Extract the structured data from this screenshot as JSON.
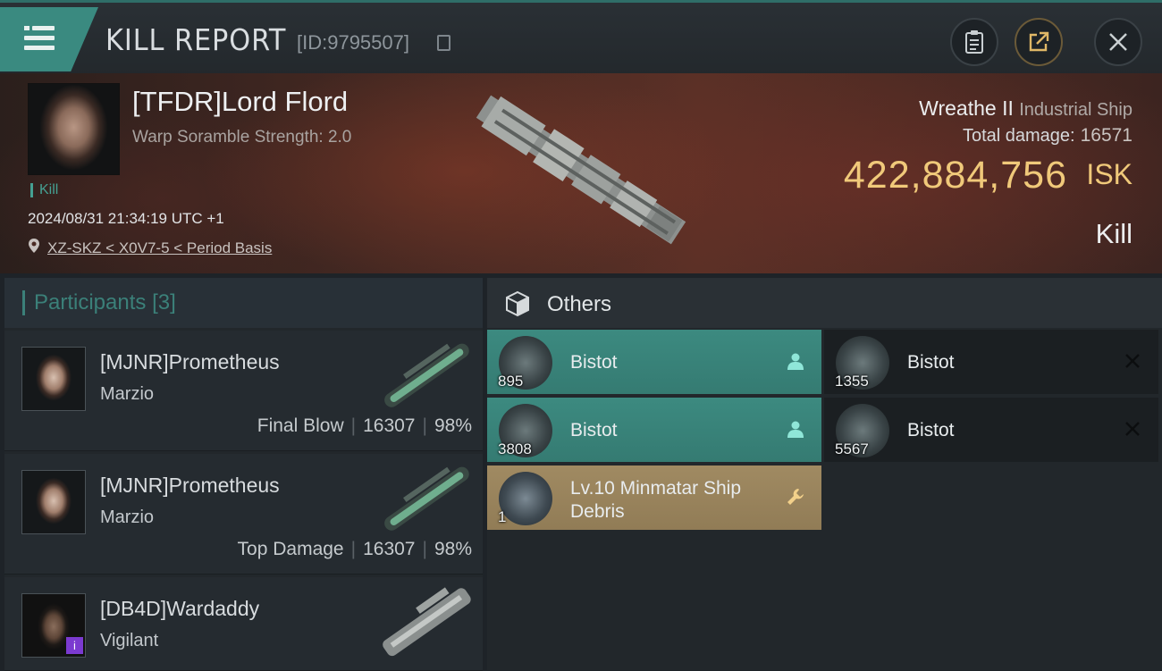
{
  "header": {
    "title": "KILL REPORT",
    "report_id": "[ID:9795507]"
  },
  "victim": {
    "name": "[TFDR]Lord Flord",
    "stat": "Warp Soramble Strength: 2.0",
    "tag": "Kill",
    "timestamp": "2024/08/31 21:34:19 UTC +1",
    "location": "XZ-SKZ < X0V7-5 < Period Basis",
    "ship": "Wreathe II",
    "ship_class": "Industrial Ship",
    "total_damage_label": "Total damage:",
    "total_damage": "16571",
    "isk_value": "422,884,756",
    "isk_unit": "ISK",
    "result": "Kill"
  },
  "participants": {
    "title": "Participants",
    "count": "[3]",
    "rows": [
      {
        "name": "[MJNR]Prometheus",
        "ship": "Marzio",
        "role": "Final Blow",
        "damage": "16307",
        "percent": "98%"
      },
      {
        "name": "[MJNR]Prometheus",
        "ship": "Marzio",
        "role": "Top Damage",
        "damage": "16307",
        "percent": "98%"
      },
      {
        "name": "[DB4D]Wardaddy",
        "ship": "Vigilant",
        "role": "",
        "damage": "",
        "percent": "",
        "badge": "i"
      }
    ]
  },
  "others": {
    "title": "Others",
    "items": [
      {
        "name": "Bistot",
        "qty": "895",
        "style": "teal",
        "tag": "person-icon"
      },
      {
        "name": "Bistot",
        "qty": "1355",
        "style": "dark",
        "tag": "close-icon"
      },
      {
        "name": "Bistot",
        "qty": "3808",
        "style": "teal",
        "tag": "person-icon"
      },
      {
        "name": "Bistot",
        "qty": "5567",
        "style": "dark",
        "tag": "close-icon"
      },
      {
        "name": "Lv.10 Minmatar Ship Debris",
        "qty": "1",
        "style": "gold",
        "tag": "wrench-icon"
      }
    ]
  },
  "colors": {
    "accent_teal": "#3c8a80",
    "isk_gold": "#f0c97a",
    "debris_gold": "#a08a62"
  }
}
